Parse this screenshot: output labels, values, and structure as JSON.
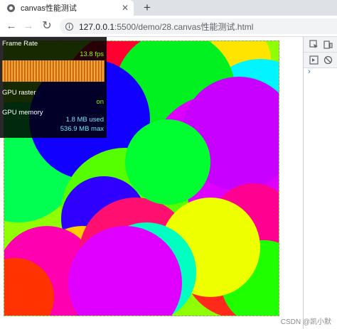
{
  "browser": {
    "tab_title": "canvas性能测试",
    "tab_close": "✕",
    "new_tab": "+",
    "back": "←",
    "forward": "→",
    "reload": "↻",
    "info": "i",
    "url_host": "127.0.0.1",
    "url_rest": ":5500/demo/28.canvas性能测试.html"
  },
  "fps_meter": {
    "frame_rate_label": "Frame Rate",
    "fps_value": "13.8 fps",
    "gpu_raster_label": "GPU raster",
    "gpu_raster_value": "on",
    "gpu_memory_label": "GPU memory",
    "memory_used": "1.8 MB used",
    "memory_max": "536.9 MB max"
  },
  "devtools": {
    "chevron": "›"
  },
  "watermark": "CSDN @凯小默",
  "colors": {
    "canvas_bg": "#90ff06",
    "fps_graph": "#d06a0f",
    "fps_green": "#80ff00",
    "fps_cyan": "#6ee6f5"
  }
}
